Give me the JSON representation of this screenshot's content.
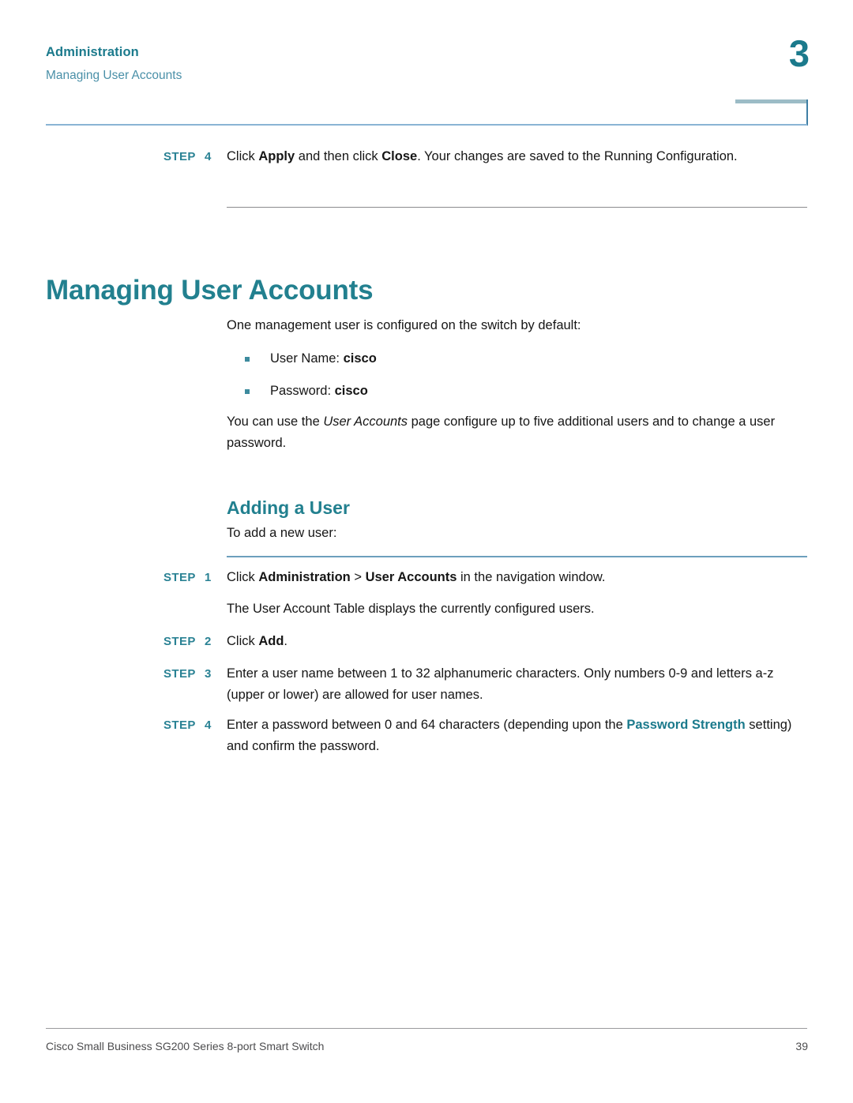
{
  "header": {
    "chapter_title": "Administration",
    "section_title": "Managing User Accounts",
    "chapter_number": "3"
  },
  "top_step": {
    "label": "STEP",
    "number": "4",
    "text_part1": "Click ",
    "bold1": "Apply",
    "text_part2": " and then click ",
    "bold2": "Close",
    "text_part3": ". Your changes are saved to the Running Configuration."
  },
  "main_heading": "Managing User Accounts",
  "intro_paragraph": "One management user is configured on the switch by default:",
  "bullets": [
    {
      "label": "User Name: ",
      "value": "cisco"
    },
    {
      "label": "Password: ",
      "value": "cisco"
    }
  ],
  "usage_paragraph": {
    "part1": "You can use the ",
    "italic": "User Accounts",
    "part2": " page configure up to five additional users and to change a user password."
  },
  "sub_heading": "Adding a User",
  "lead_in": "To add a new user:",
  "steps": [
    {
      "label": "STEP",
      "number": "1",
      "text_part1": "Click ",
      "bold1": "Administration",
      "text_part2": " > ",
      "bold2": "User Accounts",
      "text_part3": " in the navigation window."
    },
    {
      "label": "STEP",
      "number": "2",
      "text_part1": "Click ",
      "bold1": "Add",
      "text_part2": ".",
      "bold2": "",
      "text_part3": ""
    },
    {
      "label": "STEP",
      "number": "3",
      "text_part1": "Enter a user name between 1 to 32 alphanumeric characters. Only numbers 0-9 and letters a-z (upper or lower) are allowed for user names.",
      "bold1": "",
      "text_part2": "",
      "bold2": "",
      "text_part3": ""
    },
    {
      "label": "STEP",
      "number": "4",
      "text_part1": "Enter a password between 0 and 64 characters (depending upon the ",
      "link": "Password Strength",
      "text_part2": " setting) and confirm the password."
    }
  ],
  "step1_note": "The User Account Table displays the currently configured users.",
  "footer": {
    "product": "Cisco Small Business SG200 Series 8-port Smart Switch",
    "page_number": "39"
  },
  "colors": {
    "heading_teal": "#22808f",
    "header_teal": "#1b7a8c",
    "subtitle_blue": "#4a90a8",
    "step_label_teal": "#2a8294",
    "rule_blue": "#6c9fbd",
    "rule_gray": "#8b8b8e",
    "bullet_teal": "#3d8b9e"
  }
}
